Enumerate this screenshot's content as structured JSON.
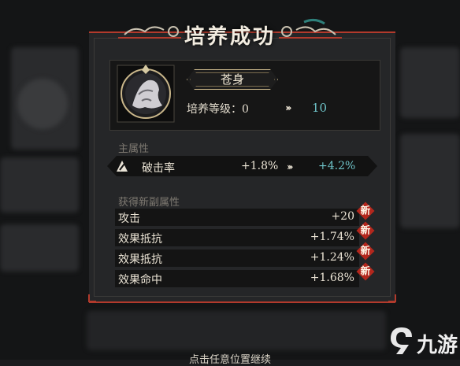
{
  "title": "培养成功",
  "hero": {
    "name": "苍身",
    "level_label": "培养等级：0",
    "level_to": "10"
  },
  "main_attr": {
    "section_title": "主属性",
    "name": "破击率",
    "from": "+1.8%",
    "to": "+4.2%"
  },
  "sub_attrs": {
    "section_title": "获得新副属性",
    "badge": "新",
    "items": [
      {
        "name": "攻击",
        "value": "+20"
      },
      {
        "name": "效果抵抗",
        "value": "+1.74%"
      },
      {
        "name": "效果抵抗",
        "value": "+1.24%"
      },
      {
        "name": "效果命中",
        "value": "+1.68%"
      }
    ]
  },
  "hint": "点击任意位置继续",
  "watermark": "九游",
  "colors": {
    "accent_red": "#b23a2c",
    "teal_value": "#6fc4c9",
    "badge_red": "#b3271d"
  }
}
